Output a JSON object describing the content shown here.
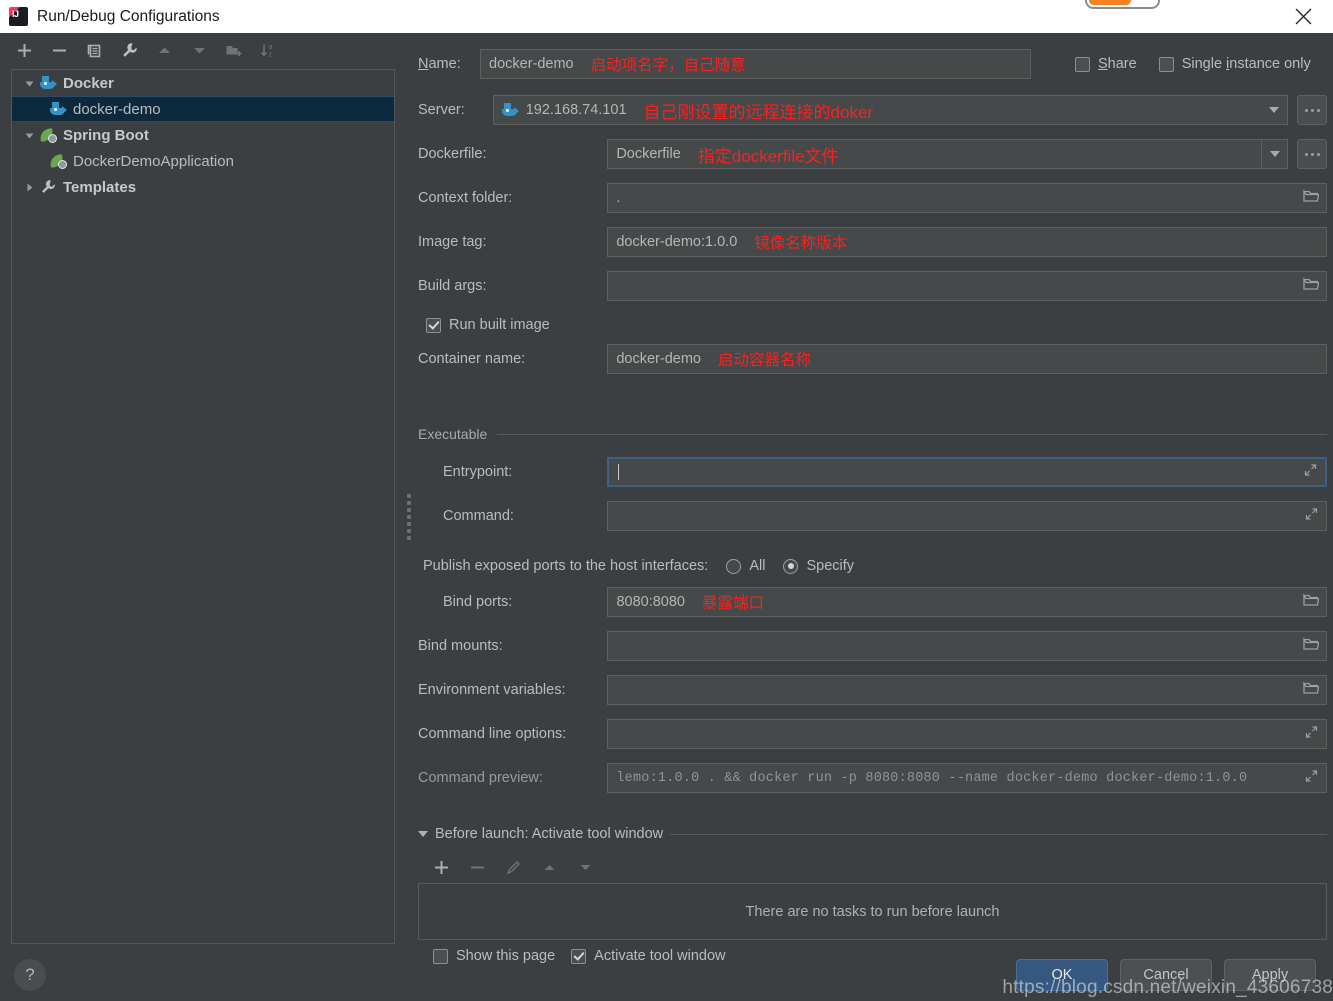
{
  "window": {
    "title": "Run/Debug Configurations",
    "logo_icon": "intellij-idea-logo-icon",
    "close_icon": "close-icon",
    "progress_icon": "progress-bar"
  },
  "tree_toolbar": [
    {
      "name": "add-configuration-button",
      "icon": "plus-icon",
      "enabled": true
    },
    {
      "name": "remove-configuration-button",
      "icon": "minus-icon",
      "enabled": true
    },
    {
      "name": "copy-configuration-button",
      "icon": "copy-icon",
      "enabled": true
    },
    {
      "name": "edit-templates-button",
      "icon": "wrench-icon",
      "enabled": true
    },
    {
      "name": "move-up-button",
      "icon": "arrow-up-icon",
      "enabled": false
    },
    {
      "name": "move-down-button",
      "icon": "arrow-down-icon",
      "enabled": false
    },
    {
      "name": "new-folder-button",
      "icon": "folder-add-icon",
      "enabled": false
    },
    {
      "name": "sort-configurations-button",
      "icon": "sort-alpha-icon",
      "enabled": false
    }
  ],
  "tree": {
    "items": [
      {
        "label": "Docker",
        "icon": "docker-icon",
        "level": 0,
        "expanded": true,
        "bold": true,
        "selected": false
      },
      {
        "label": "docker-demo",
        "icon": "docker-icon",
        "level": 1,
        "expanded": null,
        "bold": false,
        "selected": true
      },
      {
        "label": "Spring Boot",
        "icon": "spring-icon",
        "level": 0,
        "expanded": true,
        "bold": true,
        "selected": false
      },
      {
        "label": "DockerDemoApplication",
        "icon": "spring-icon",
        "level": 1,
        "expanded": null,
        "bold": false,
        "selected": false
      },
      {
        "label": "Templates",
        "icon": "wrench-icon",
        "level": 0,
        "expanded": false,
        "bold": true,
        "selected": false
      }
    ]
  },
  "help_button": {
    "label": "?",
    "name": "help-button"
  },
  "form": {
    "name": {
      "label": "Name:",
      "label_mnemonic": "N",
      "value": "docker-demo",
      "annotation": "启动项名字，自己随意"
    },
    "share": {
      "label": "Share",
      "label_mnemonic": "S",
      "checked": false
    },
    "single_instance": {
      "label": "Single instance only",
      "label_mnemonic": "i",
      "checked": false
    },
    "server": {
      "label": "Server:",
      "value": "192.168.74.101",
      "icon": "docker-icon",
      "annotation": "自己刚设置的远程连接的doker",
      "browse_label": "..."
    },
    "dockerfile": {
      "label": "Dockerfile:",
      "value": "Dockerfile",
      "annotation": "指定dockerfile文件",
      "browse_label": "..."
    },
    "context_folder": {
      "label": "Context folder:",
      "value": ".",
      "annotation": ""
    },
    "image_tag": {
      "label": "Image tag:",
      "value": "docker-demo:1.0.0",
      "annotation": "镜像名称版本"
    },
    "build_args": {
      "label": "Build args:",
      "value": "",
      "annotation": ""
    },
    "run_built_image": {
      "label": "Run built image",
      "checked": true
    },
    "container_name": {
      "label": "Container name:",
      "value": "docker-demo",
      "annotation": "启动容器名称"
    },
    "executable_group": {
      "label": "Executable"
    },
    "entrypoint": {
      "label": "Entrypoint:",
      "value": "",
      "focused": true
    },
    "command": {
      "label": "Command:",
      "value": ""
    },
    "publish_ports": {
      "label": "Publish exposed ports to the host interfaces:",
      "options": [
        {
          "label": "All",
          "selected": false
        },
        {
          "label": "Specify",
          "selected": true
        }
      ]
    },
    "bind_ports": {
      "label": "Bind ports:",
      "value": "8080:8080",
      "annotation": "暴露端口"
    },
    "bind_mounts": {
      "label": "Bind mounts:",
      "value": ""
    },
    "environment_variables": {
      "label": "Environment variables:",
      "value": ""
    },
    "command_line_options": {
      "label": "Command line options:",
      "value": ""
    },
    "command_preview": {
      "label": "Command preview:",
      "value": "lemo:1.0.0 . && docker run -p 8080:8080 --name docker-demo docker-demo:1.0.0"
    }
  },
  "before_launch": {
    "header": "Before launch: Activate tool window",
    "header_mnemonic": "B",
    "toolbar": [
      {
        "name": "add-task-button",
        "icon": "plus-icon",
        "enabled": true
      },
      {
        "name": "remove-task-button",
        "icon": "minus-icon",
        "enabled": false
      },
      {
        "name": "edit-task-button",
        "icon": "pencil-icon",
        "enabled": false
      },
      {
        "name": "move-task-up-button",
        "icon": "arrow-up-icon",
        "enabled": false
      },
      {
        "name": "move-task-down-button",
        "icon": "arrow-down-icon",
        "enabled": false
      }
    ],
    "empty_text": "There are no tasks to run before launch",
    "show_this_page": {
      "label": "Show this page",
      "checked": false
    },
    "activate_tool_window": {
      "label": "Activate tool window",
      "checked": true
    }
  },
  "footer": {
    "ok": "OK",
    "cancel": "Cancel",
    "apply": "Apply"
  },
  "watermark": "https://blog.csdn.net/weixin_43606738",
  "colors": {
    "accent": "#365880",
    "annotation": "#ff1f1f",
    "selection": "#0d293e",
    "docker_blue": "#3592c4",
    "spring_green": "#6aa84f",
    "progress_orange": "#f58220"
  }
}
